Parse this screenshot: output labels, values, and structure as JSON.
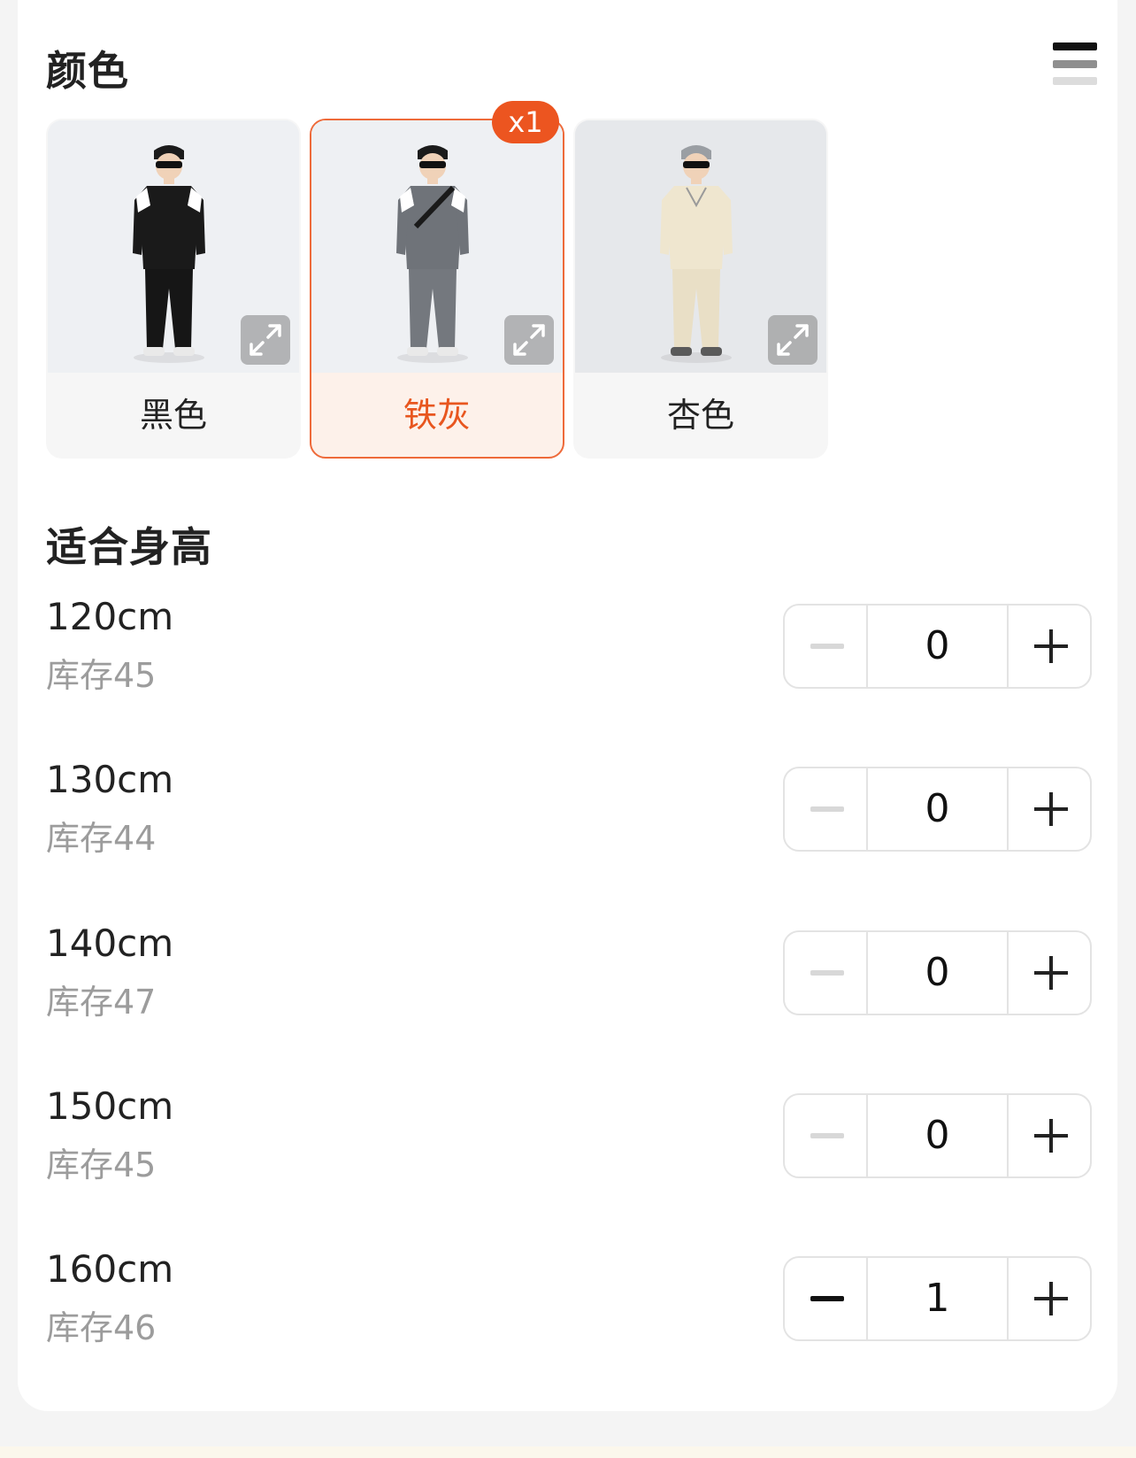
{
  "color_section": {
    "title": "颜色",
    "options": [
      {
        "label": "黑色",
        "selected": false,
        "top_color": "#1a1a1a",
        "pants_color": "#161616"
      },
      {
        "label": "铁灰",
        "selected": true,
        "badge": "x1",
        "top_color": "#6f7379",
        "pants_color": "#74787e"
      },
      {
        "label": "杏色",
        "selected": false,
        "top_color": "#efe6cf",
        "pants_color": "#e9dfc6"
      }
    ]
  },
  "height_section": {
    "title": "适合身高",
    "sizes": [
      {
        "size": "120cm",
        "stock": "库存45",
        "qty": "0"
      },
      {
        "size": "130cm",
        "stock": "库存44",
        "qty": "0"
      },
      {
        "size": "140cm",
        "stock": "库存47",
        "qty": "0"
      },
      {
        "size": "150cm",
        "stock": "库存45",
        "qty": "0"
      },
      {
        "size": "160cm",
        "stock": "库存46",
        "qty": "1"
      }
    ]
  },
  "colors": {
    "accent": "#ec5520",
    "selected_bg": "#fdf1ea",
    "muted_text": "#9c9c9c"
  }
}
